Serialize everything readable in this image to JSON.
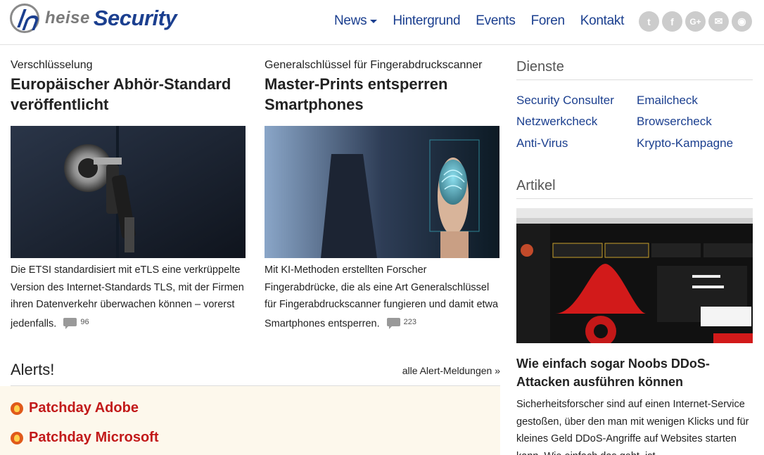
{
  "logo": {
    "heise": "heise",
    "security": "Security"
  },
  "nav": [
    {
      "label": "News",
      "has_dropdown": true
    },
    {
      "label": "Hintergrund"
    },
    {
      "label": "Events"
    },
    {
      "label": "Foren"
    },
    {
      "label": "Kontakt"
    }
  ],
  "social": [
    {
      "name": "twitter-icon",
      "glyph": "t"
    },
    {
      "name": "facebook-icon",
      "glyph": "f"
    },
    {
      "name": "google-plus-icon",
      "glyph": "G+"
    },
    {
      "name": "email-icon",
      "glyph": "✉"
    },
    {
      "name": "rss-icon",
      "glyph": "◉"
    }
  ],
  "articles": [
    {
      "kicker": "Verschlüsselung",
      "headline": "Europäischer Abhör-Standard veröffentlicht",
      "teaser": "Die ETSI standardisiert mit eTLS eine verkrüppelte Version des Internet-Standards TLS, mit der Firmen ihren Datenverkehr überwachen können – vorerst jedenfalls.",
      "comments": "96"
    },
    {
      "kicker": "Generalschlüssel für Fingerabdruckscanner",
      "headline": "Master-Prints entsperren Smartphones",
      "teaser": "Mit KI-Methoden erstellten Forscher Fingerabdrücke, die als eine Art Generalschlüssel für Fingerabdruckscanner fungieren und damit etwa Smartphones entsperren.",
      "comments": "223"
    }
  ],
  "alerts": {
    "title": "Alerts!",
    "all_link": "alle Alert-Meldungen »",
    "items": [
      "Patchday Adobe",
      "Patchday Microsoft"
    ]
  },
  "sidebar": {
    "dienste_title": "Dienste",
    "dienste": [
      "Security Consulter",
      "Emailcheck",
      "Netzwerkcheck",
      "Browsercheck",
      "Anti-Virus",
      "Krypto-Kampagne"
    ],
    "artikel_title": "Artikel",
    "artikel_headline": "Wie einfach sogar Noobs DDoS-Attacken ausführen können",
    "artikel_teaser": "Sicherheitsforscher sind auf einen Internet-Service gestoßen, über den man mit wenigen Klicks und für kleines Geld DDoS-Angriffe auf Websites starten kann. Wie einfach das geht, ist"
  },
  "colors": {
    "brand": "#1b3f8f",
    "alert": "#c21a1a",
    "alert_bg": "#fdf8ec"
  }
}
